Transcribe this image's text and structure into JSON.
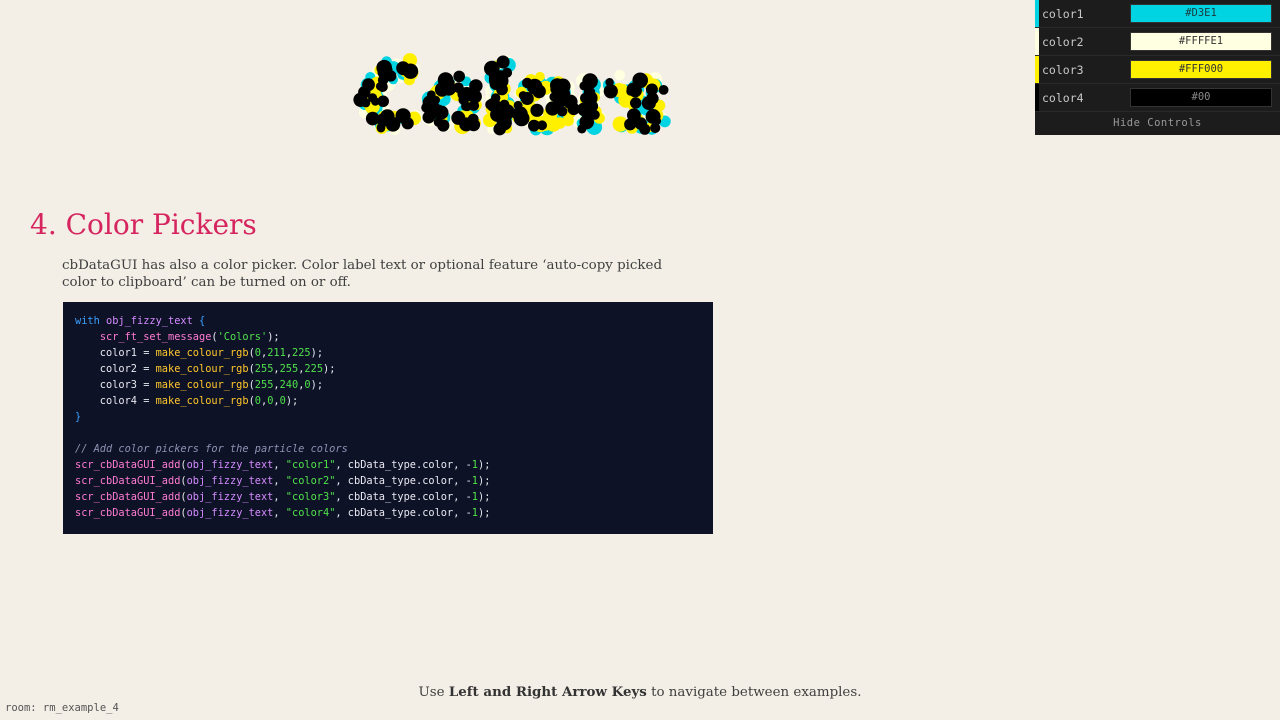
{
  "title_particles": {
    "message": "Colors",
    "colors": [
      "#00D3E1",
      "#FFFFE1",
      "#FFF000",
      "#000000"
    ]
  },
  "section": {
    "heading": "4. Color Pickers",
    "description": "cbDataGUI has also a color picker. Color label text or optional feature ‘auto-copy picked color to clipboard’ can be turned on or off."
  },
  "code": {
    "lines": [
      [
        {
          "t": "with ",
          "c": "kw"
        },
        {
          "t": "obj_fizzy_text",
          "c": "var"
        },
        {
          "t": " {",
          "c": "kw"
        }
      ],
      [
        {
          "t": "    ",
          "c": "op"
        },
        {
          "t": "scr_ft_set_message",
          "c": "fn2"
        },
        {
          "t": "(",
          "c": "op"
        },
        {
          "t": "'Colors'",
          "c": "str"
        },
        {
          "t": ");",
          "c": "op"
        }
      ],
      [
        {
          "t": "    color1 = ",
          "c": "op"
        },
        {
          "t": "make_colour_rgb",
          "c": "fn"
        },
        {
          "t": "(",
          "c": "op"
        },
        {
          "t": "0",
          "c": "num"
        },
        {
          "t": ",",
          "c": "op"
        },
        {
          "t": "211",
          "c": "num"
        },
        {
          "t": ",",
          "c": "op"
        },
        {
          "t": "225",
          "c": "num"
        },
        {
          "t": ");",
          "c": "op"
        }
      ],
      [
        {
          "t": "    color2 = ",
          "c": "op"
        },
        {
          "t": "make_colour_rgb",
          "c": "fn"
        },
        {
          "t": "(",
          "c": "op"
        },
        {
          "t": "255",
          "c": "num"
        },
        {
          "t": ",",
          "c": "op"
        },
        {
          "t": "255",
          "c": "num"
        },
        {
          "t": ",",
          "c": "op"
        },
        {
          "t": "225",
          "c": "num"
        },
        {
          "t": ");",
          "c": "op"
        }
      ],
      [
        {
          "t": "    color3 = ",
          "c": "op"
        },
        {
          "t": "make_colour_rgb",
          "c": "fn"
        },
        {
          "t": "(",
          "c": "op"
        },
        {
          "t": "255",
          "c": "num"
        },
        {
          "t": ",",
          "c": "op"
        },
        {
          "t": "240",
          "c": "num"
        },
        {
          "t": ",",
          "c": "op"
        },
        {
          "t": "0",
          "c": "num"
        },
        {
          "t": ");",
          "c": "op"
        }
      ],
      [
        {
          "t": "    color4 = ",
          "c": "op"
        },
        {
          "t": "make_colour_rgb",
          "c": "fn"
        },
        {
          "t": "(",
          "c": "op"
        },
        {
          "t": "0",
          "c": "num"
        },
        {
          "t": ",",
          "c": "op"
        },
        {
          "t": "0",
          "c": "num"
        },
        {
          "t": ",",
          "c": "op"
        },
        {
          "t": "0",
          "c": "num"
        },
        {
          "t": ");",
          "c": "op"
        }
      ],
      [
        {
          "t": "}",
          "c": "kw"
        }
      ],
      [],
      [
        {
          "t": "// Add color pickers for the particle colors",
          "c": "comment"
        }
      ],
      [
        {
          "t": "scr_cbDataGUI_add",
          "c": "fn2"
        },
        {
          "t": "(",
          "c": "op"
        },
        {
          "t": "obj_fizzy_text",
          "c": "var"
        },
        {
          "t": ", ",
          "c": "op"
        },
        {
          "t": "\"color1\"",
          "c": "str"
        },
        {
          "t": ", cbData_type.color, -",
          "c": "op"
        },
        {
          "t": "1",
          "c": "num"
        },
        {
          "t": ");",
          "c": "op"
        }
      ],
      [
        {
          "t": "scr_cbDataGUI_add",
          "c": "fn2"
        },
        {
          "t": "(",
          "c": "op"
        },
        {
          "t": "obj_fizzy_text",
          "c": "var"
        },
        {
          "t": ", ",
          "c": "op"
        },
        {
          "t": "\"color2\"",
          "c": "str"
        },
        {
          "t": ", cbData_type.color, -",
          "c": "op"
        },
        {
          "t": "1",
          "c": "num"
        },
        {
          "t": ");",
          "c": "op"
        }
      ],
      [
        {
          "t": "scr_cbDataGUI_add",
          "c": "fn2"
        },
        {
          "t": "(",
          "c": "op"
        },
        {
          "t": "obj_fizzy_text",
          "c": "var"
        },
        {
          "t": ", ",
          "c": "op"
        },
        {
          "t": "\"color3\"",
          "c": "str"
        },
        {
          "t": ", cbData_type.color, -",
          "c": "op"
        },
        {
          "t": "1",
          "c": "num"
        },
        {
          "t": ");",
          "c": "op"
        }
      ],
      [
        {
          "t": "scr_cbDataGUI_add",
          "c": "fn2"
        },
        {
          "t": "(",
          "c": "op"
        },
        {
          "t": "obj_fizzy_text",
          "c": "var"
        },
        {
          "t": ", ",
          "c": "op"
        },
        {
          "t": "\"color4\"",
          "c": "str"
        },
        {
          "t": ", cbData_type.color, -",
          "c": "op"
        },
        {
          "t": "1",
          "c": "num"
        },
        {
          "t": ");",
          "c": "op"
        }
      ]
    ]
  },
  "gui": {
    "rows": [
      {
        "label": "color1",
        "value": "#D3E1",
        "color": "#00D3E1",
        "text_color": "#1b3a3d"
      },
      {
        "label": "color2",
        "value": "#FFFFE1",
        "color": "#FFFFE1",
        "text_color": "#333333"
      },
      {
        "label": "color3",
        "value": "#FFF000",
        "color": "#FFF000",
        "text_color": "#333333"
      },
      {
        "label": "color4",
        "value": "#00",
        "color": "#000000",
        "text_color": "#8a8a8a"
      }
    ],
    "hide_label": "Hide Controls"
  },
  "footer": {
    "nav_prefix": "Use ",
    "nav_keys": "Left and Right Arrow Keys",
    "nav_suffix": " to navigate between examples.",
    "room": "room: rm_example_4"
  }
}
